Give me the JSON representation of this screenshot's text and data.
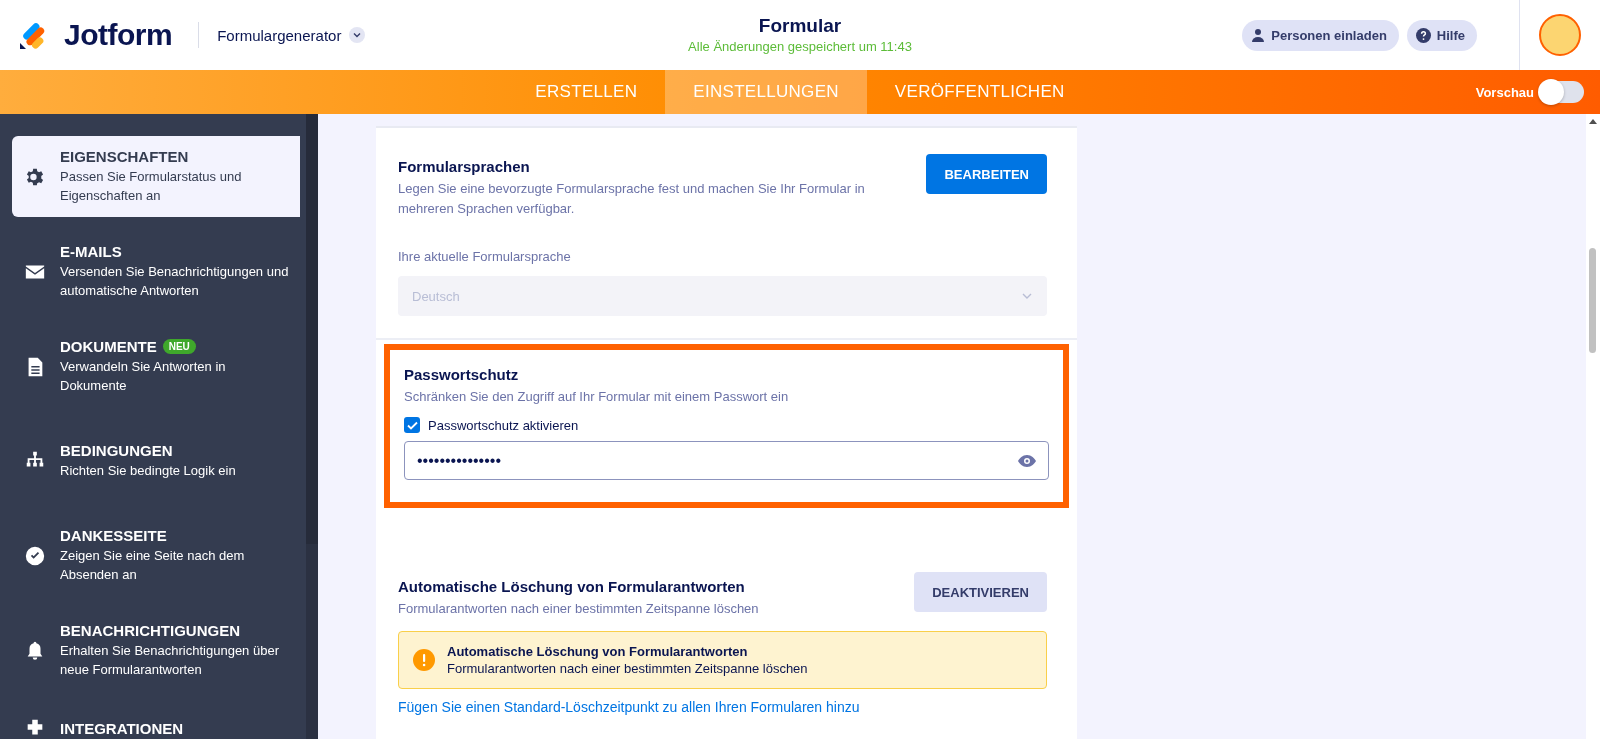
{
  "header": {
    "logo_text": "Jotform",
    "builder_label": "Formulargenerator",
    "title": "Formular",
    "saved_status": "Alle Änderungen gespeichert um 11:43",
    "invite_button": "Personen einladen",
    "help_button": "Hilfe"
  },
  "nav": {
    "tabs": [
      {
        "label": "ERSTELLEN",
        "selected": false
      },
      {
        "label": "EINSTELLUNGEN",
        "selected": true
      },
      {
        "label": "VERÖFFENTLICHEN",
        "selected": false
      }
    ],
    "preview": {
      "label": "Vorschau",
      "on": false
    }
  },
  "sidebar": {
    "items": [
      {
        "title": "EIGENSCHAFTEN",
        "description": "Passen Sie Formularstatus und Eigenschaften an",
        "selected": true
      },
      {
        "title": "E-MAILS",
        "description": "Versenden Sie Benachrichtigungen und automatische Antworten",
        "selected": false
      },
      {
        "title": "DOKUMENTE",
        "badge": "NEU",
        "description": "Verwandeln Sie Antworten in Dokumente",
        "selected": false
      },
      {
        "title": "BEDINGUNGEN",
        "description": "Richten Sie bedingte Logik ein",
        "selected": false
      },
      {
        "title": "DANKESSEITE",
        "description": "Zeigen Sie eine Seite nach dem Absenden an",
        "selected": false
      },
      {
        "title": "BENACHRICHTIGUNGEN",
        "description": "Erhalten Sie Benachrichtigungen über neue Formularantworten",
        "selected": false
      },
      {
        "title": "INTEGRATIONEN",
        "selected": false
      }
    ]
  },
  "form_languages": {
    "title": "Formularsprachen",
    "description": "Legen Sie eine bevorzugte Formularsprache fest und machen Sie Ihr Formular in mehreren Sprachen verfügbar.",
    "button": "BEARBEITEN",
    "field_label": "Ihre aktuelle Formularsprache",
    "field_value": "Deutsch",
    "disabled": true
  },
  "password": {
    "title": "Passwortschutz",
    "description": "Schränken Sie den Zugriff auf Ihr Formular mit einem Passwort ein",
    "checkbox": {
      "label": "Passwortschutz aktivieren",
      "checked": true
    },
    "value": "•••••••••••••••",
    "highlighted": true
  },
  "auto_delete": {
    "title": "Automatische Löschung von Formularantworten",
    "description": "Formularantworten nach einer bestimmten Zeitspanne löschen",
    "button": "DEAKTIVIEREN",
    "alert": {
      "title": "Automatische Löschung von Formularantworten",
      "text": "Formularantworten nach einer bestimmten Zeitspanne löschen"
    },
    "link": "Fügen Sie einen Standard-Löschzeitpunkt zu allen Ihren Formularen hinzu"
  }
}
